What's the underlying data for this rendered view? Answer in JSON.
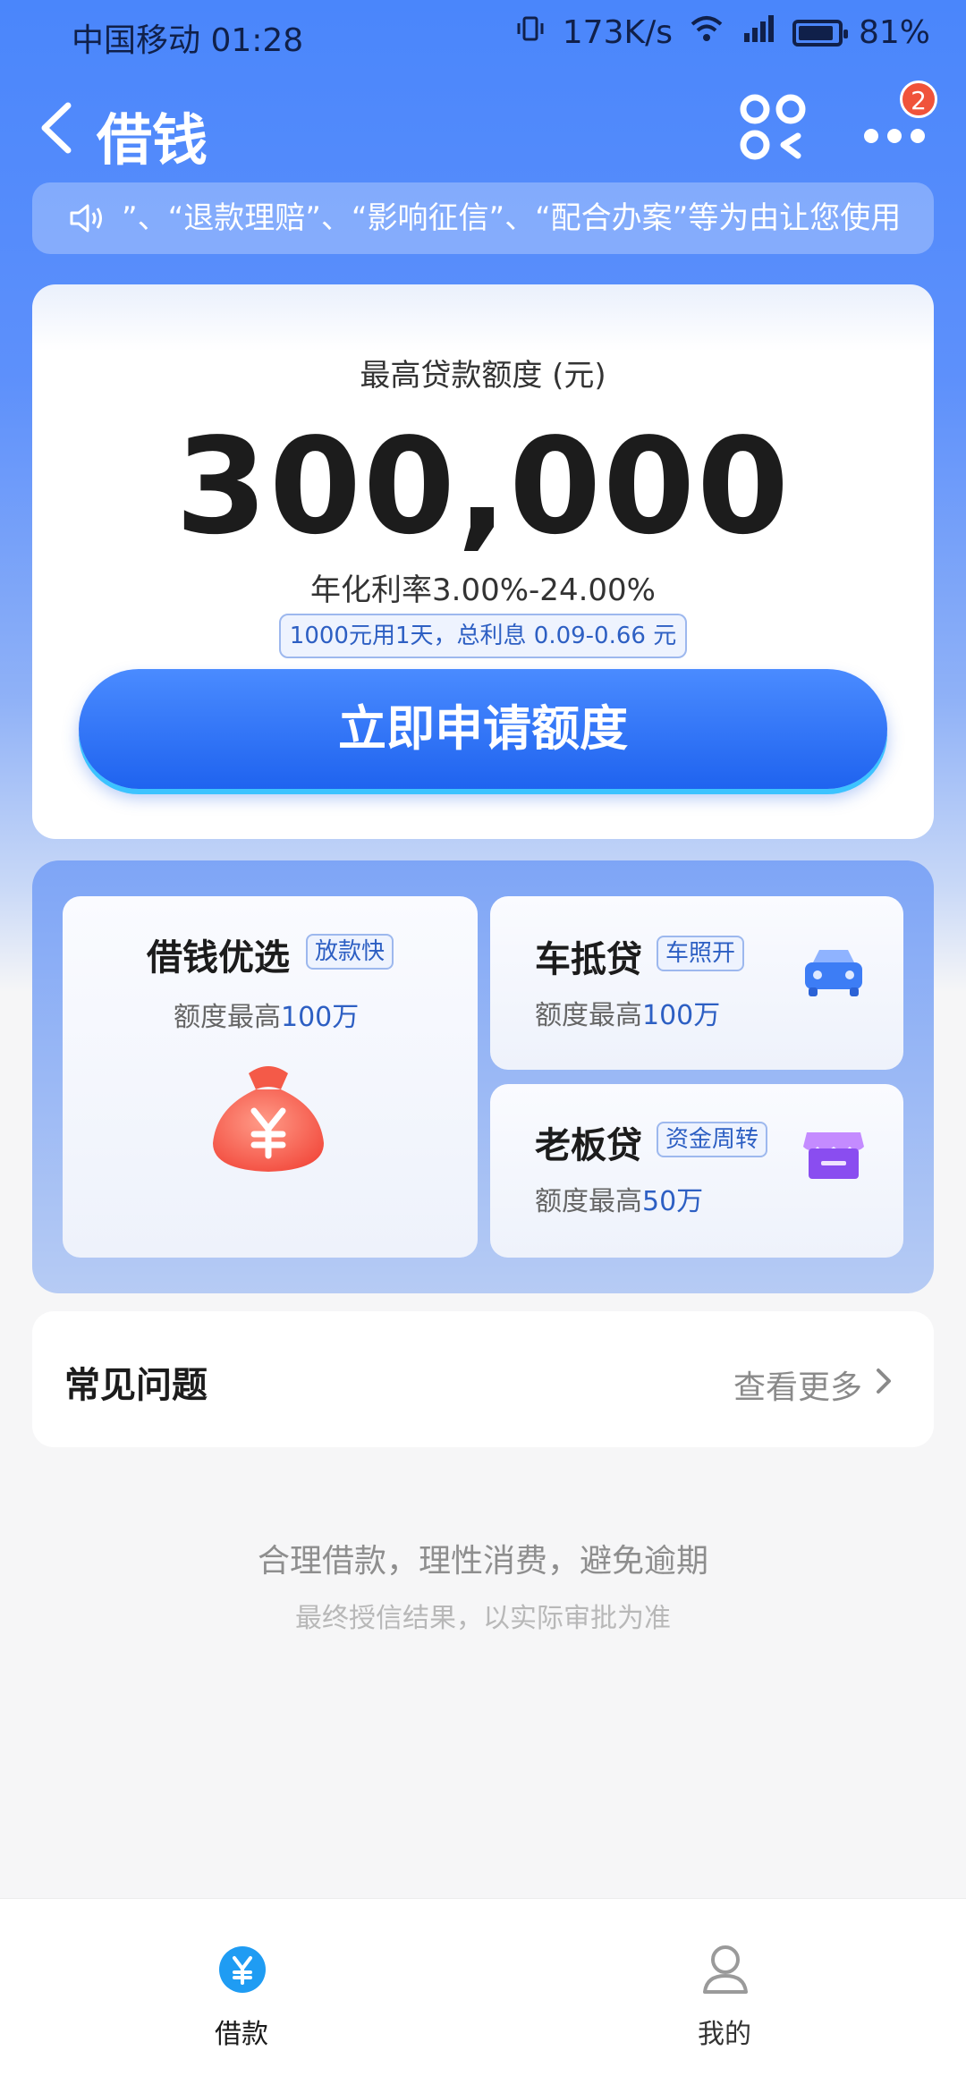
{
  "status_bar": {
    "carrier_time": "中国移动 01:28",
    "speed": "173K/s",
    "battery": "81%"
  },
  "nav": {
    "title": "借钱",
    "badge_count": "2"
  },
  "notice": {
    "text": "”、“退款理赔”、“影响征信”、“配合办案”等为由让您使用"
  },
  "loan": {
    "limit_label": "最高贷款额度 (元)",
    "limit_amount": "300,000",
    "rate": "年化利率3.00%-24.00%",
    "interest_example": "1000元用1天，总利息 0.09-0.66 元",
    "apply_label": "立即申请额度"
  },
  "products": [
    {
      "title": "借钱优选",
      "tag": "放款快",
      "sub_prefix": "额度最高",
      "sub_value": "100万"
    },
    {
      "title": "车抵贷",
      "tag": "车照开",
      "sub_prefix": "额度最高",
      "sub_value": "100万"
    },
    {
      "title": "老板贷",
      "tag": "资金周转",
      "sub_prefix": "额度最高",
      "sub_value": "50万"
    }
  ],
  "faq": {
    "title": "常见问题",
    "more": "查看更多"
  },
  "footer": {
    "slogan": "合理借款，理性消费，避免逾期",
    "sub": "最终授信结果，以实际审批为准"
  },
  "tabbar": {
    "tabs": [
      {
        "label": "借款",
        "icon": "yuan-icon",
        "active": true
      },
      {
        "label": "我的",
        "icon": "person-icon",
        "active": false
      }
    ]
  },
  "colors": {
    "brand_blue": "#1f63ef",
    "accent_light": "#3cc3ff",
    "badge_red": "#f0533b"
  }
}
